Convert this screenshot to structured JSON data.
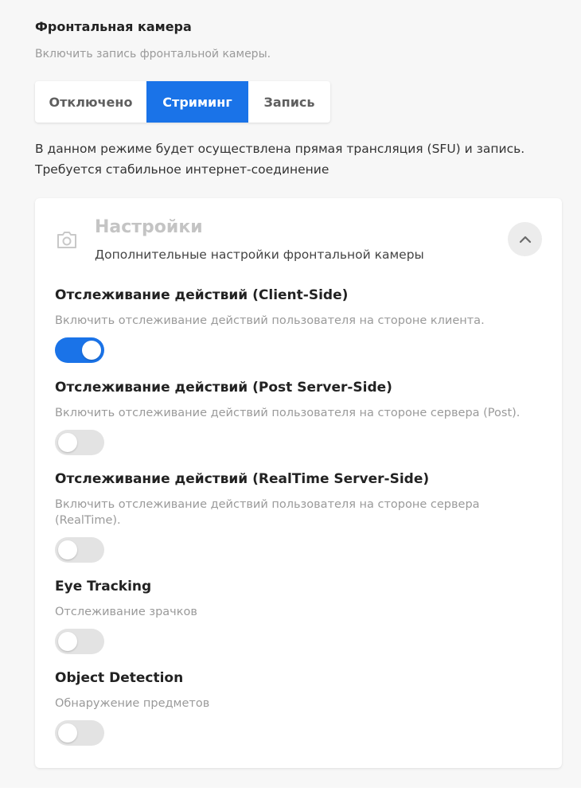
{
  "section": {
    "title": "Фронтальная камера",
    "subtitle": "Включить запись фронтальной камеры."
  },
  "mode_selector": {
    "options": [
      "Отключено",
      "Стриминг",
      "Запись"
    ],
    "selected": "Стриминг"
  },
  "mode_description": "В данном режиме будет осуществлена прямая трансляция (SFU) и запись. Требуется стабильное интернет-соединение",
  "settings_card": {
    "title": "Настройки",
    "subtitle": "Дополнительные настройки фронтальной камеры",
    "icon": "camera-icon",
    "collapse_icon": "chevron-up-icon",
    "items": [
      {
        "title": "Отслеживание действий (Client-Side)",
        "description": "Включить отслеживание действий пользователя на стороне клиента.",
        "enabled": true
      },
      {
        "title": "Отслеживание действий (Post Server-Side)",
        "description": "Включить отслеживание действий пользователя на стороне сервера (Post).",
        "enabled": false
      },
      {
        "title": "Отслеживание действий (RealTime Server-Side)",
        "description": "Включить отслеживание действий пользователя на стороне сервера (RealTime).",
        "enabled": false
      },
      {
        "title": "Eye Tracking",
        "description": "Отслеживание зрачков",
        "enabled": false
      },
      {
        "title": "Object Detection",
        "description": "Обнаружение предметов",
        "enabled": false
      }
    ]
  },
  "colors": {
    "accent": "#1a73e8",
    "toggle_off": "#e3e3e3",
    "background": "#f7f7f7"
  }
}
